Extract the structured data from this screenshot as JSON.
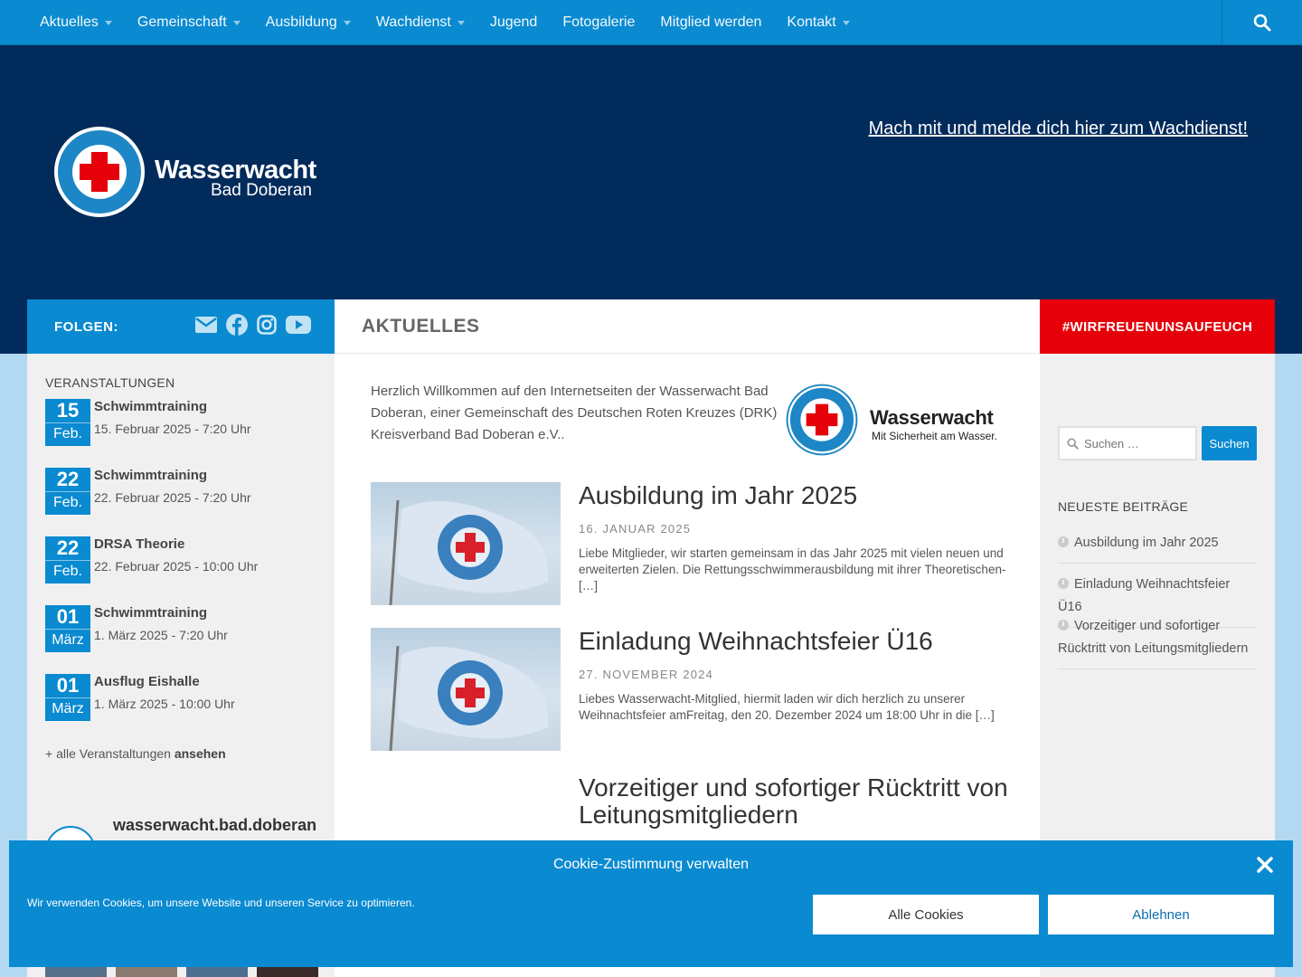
{
  "nav": {
    "items": [
      {
        "label": "Aktuelles",
        "has_submenu": true
      },
      {
        "label": "Gemeinschaft",
        "has_submenu": true
      },
      {
        "label": "Ausbildung",
        "has_submenu": true
      },
      {
        "label": "Wachdienst",
        "has_submenu": true
      },
      {
        "label": "Jugend",
        "has_submenu": false
      },
      {
        "label": "Fotogalerie",
        "has_submenu": false
      },
      {
        "label": "Mitglied werden",
        "has_submenu": false
      },
      {
        "label": "Kontakt",
        "has_submenu": true
      }
    ],
    "search_icon": "search-icon"
  },
  "header": {
    "logo_title": "Wasserwacht",
    "logo_subtitle": "Bad Doberan",
    "logo_ring_top": "DEUTSCHES ROTES KREUZ",
    "logo_ring_bottom": "WASSERWACHT",
    "cta_link": "Mach mit und melde dich hier zum Wachdienst!"
  },
  "left_sidebar": {
    "follow_label": "FOLGEN:",
    "social_icons": [
      "email-icon",
      "facebook-icon",
      "instagram-icon",
      "youtube-icon"
    ],
    "events_heading": "VERANSTALTUNGEN",
    "events": [
      {
        "day": "15",
        "month": "Feb.",
        "title": "Schwimmtraining",
        "datetime": "15. Februar 2025 - 7:20 Uhr"
      },
      {
        "day": "22",
        "month": "Feb.",
        "title": "Schwimmtraining",
        "datetime": "22. Februar 2025 - 7:20 Uhr"
      },
      {
        "day": "22",
        "month": "Feb.",
        "title": "DRSA Theorie",
        "datetime": "22. Februar 2025 - 10:00 Uhr"
      },
      {
        "day": "01",
        "month": "März",
        "title": "Schwimmtraining",
        "datetime": "1. März 2025 - 7:20 Uhr"
      },
      {
        "day": "01",
        "month": "März",
        "title": "Ausflug Eishalle",
        "datetime": "1. März 2025 - 10:00 Uhr"
      }
    ],
    "all_events_prefix": "+ alle Veranstaltungen",
    "all_events_link": "ansehen",
    "instagram_name": "wasserwacht.bad.doberan"
  },
  "main": {
    "page_title": "AKTUELLES",
    "intro": "Herzlich Willkommen auf den Internetseiten der Wasserwacht Bad Doberan, einer Gemeinschaft des Deutschen Roten Kreuzes (DRK) Kreisverband Bad Doberan e.V..",
    "intro_logo_title": "Wasserwacht",
    "intro_logo_subtitle": "Mit Sicherheit am Wasser.",
    "posts": [
      {
        "title": "Ausbildung im Jahr 2025",
        "date": "16. JANUAR 2025",
        "excerpt": "Liebe Mitglieder, wir starten gemeinsam in das Jahr 2025 mit vielen neuen und erweiterten Zielen. Die Rettungsschwimmerausbildung mit ihrer Theoretischen- […]"
      },
      {
        "title": "Einladung Weihnachtsfeier Ü16",
        "date": "27. NOVEMBER 2024",
        "excerpt": "Liebes Wasserwacht-Mitglied, hiermit laden wir dich herzlich zu unserer Weihnachtsfeier amFreitag, den 20. Dezember 2024 um 18:00 Uhr in die […]"
      },
      {
        "title_line1": "Vorzeitiger und sofortiger Rücktritt von",
        "title_line2": "Leitungsmitgliedern"
      }
    ]
  },
  "right_sidebar": {
    "hashtag": "#WIRFREUENUNSAUFEUCH",
    "search_placeholder": "Suchen …",
    "search_button": "Suchen",
    "recent_heading": "NEUESTE BEITRÄGE",
    "recent_posts": [
      "Ausbildung im Jahr 2025",
      "Einladung Weihnachtsfeier Ü16",
      "Vorzeitiger und sofortiger Rücktritt von Leitungsmitgliedern"
    ]
  },
  "cookie": {
    "title": "Cookie-Zustimmung verwalten",
    "text": "Wir verwenden Cookies, um unsere Website und unseren Service zu optimieren.",
    "accept": "Alle Cookies",
    "deny": "Ablehnen"
  },
  "colors": {
    "primary_blue": "#0a8ad0",
    "header_navy": "#012b5b",
    "accent_red": "#e5000a",
    "page_bg": "#b3d9f2"
  }
}
